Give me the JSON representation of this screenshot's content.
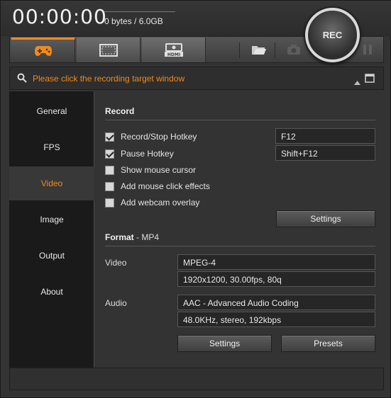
{
  "header": {
    "timer": "00:00:00",
    "size": "0 bytes / 6.0GB",
    "rec_label": "REC"
  },
  "toolbar": {
    "buttons": [
      {
        "icon": "gamepad-icon",
        "active": true
      },
      {
        "icon": "screen-rectangle-icon",
        "active": false
      },
      {
        "icon": "hdmi-icon",
        "label": "HDMI",
        "active": false
      }
    ],
    "tools": [
      "folder-open-icon",
      "camera-icon",
      "pause-icon"
    ]
  },
  "hint": {
    "text": "Please click the recording target window"
  },
  "nav": {
    "items": [
      "General",
      "FPS",
      "Video",
      "Image",
      "Output",
      "About"
    ],
    "active": "Video"
  },
  "record": {
    "title": "Record",
    "options": [
      {
        "label": "Record/Stop Hotkey",
        "checked": true,
        "value": "F12"
      },
      {
        "label": "Pause Hotkey",
        "checked": true,
        "value": "Shift+F12"
      },
      {
        "label": "Show mouse cursor",
        "checked": false
      },
      {
        "label": "Add mouse click effects",
        "checked": false
      },
      {
        "label": "Add webcam overlay",
        "checked": false
      }
    ],
    "settings_label": "Settings"
  },
  "format": {
    "title": "Format",
    "subtitle": " - MP4",
    "video_label": "Video",
    "video_codec": "MPEG-4",
    "video_detail": "1920x1200, 30.00fps, 80q",
    "audio_label": "Audio",
    "audio_codec": "AAC - Advanced Audio Coding",
    "audio_detail": "48.0KHz, stereo, 192kbps",
    "settings_label": "Settings",
    "presets_label": "Presets"
  },
  "colors": {
    "accent": "#f08a1c",
    "background": "#333333",
    "nav_background": "#1a1a1a"
  }
}
